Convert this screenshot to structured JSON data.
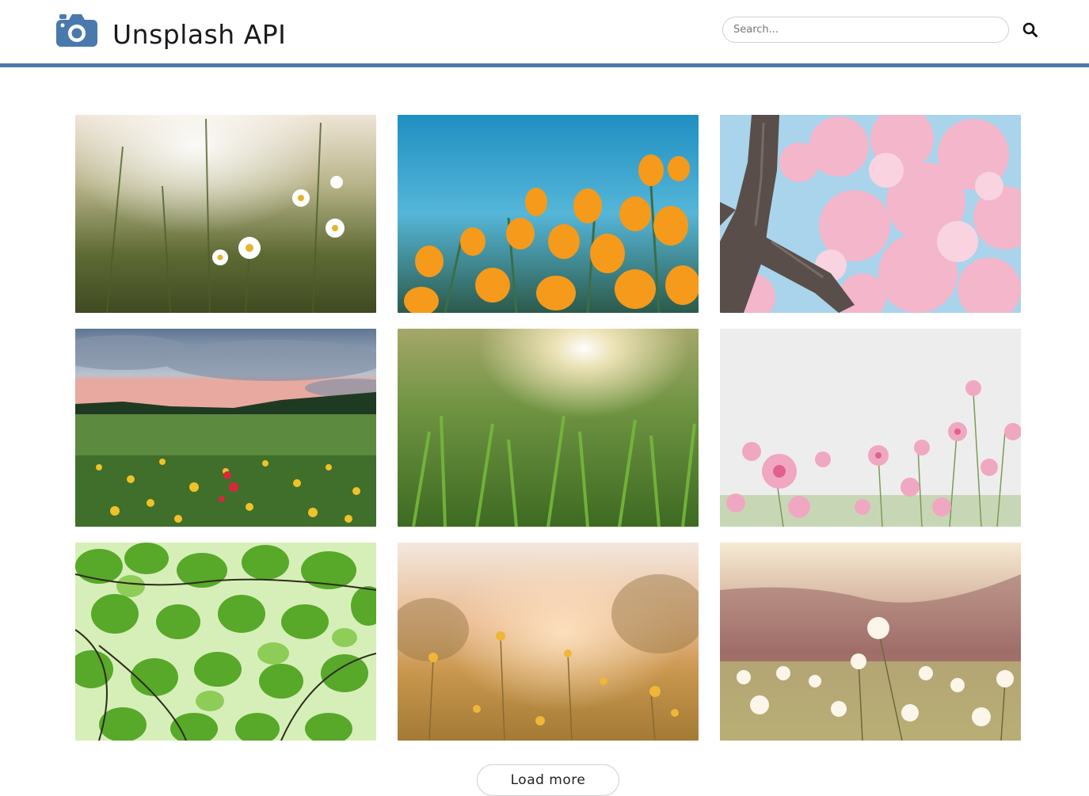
{
  "header": {
    "logo_icon": "camera-icon",
    "title": "Unsplash API",
    "accent_color": "#4a7aad"
  },
  "search": {
    "placeholder": "Search...",
    "value": "",
    "icon": "search-icon"
  },
  "gallery": {
    "photos": [
      {
        "subject": "daisies-meadow-sunset",
        "icon": "image-icon"
      },
      {
        "subject": "orange-poppies-blue-sky",
        "icon": "image-icon"
      },
      {
        "subject": "cherry-blossom-tree",
        "icon": "image-icon"
      },
      {
        "subject": "wildflower-meadow-clouds",
        "icon": "image-icon"
      },
      {
        "subject": "grass-sunlight",
        "icon": "image-icon"
      },
      {
        "subject": "pink-cosmos-flowers",
        "icon": "image-icon"
      },
      {
        "subject": "green-leaves-canopy",
        "icon": "image-icon"
      },
      {
        "subject": "golden-meadow-sunset",
        "icon": "image-icon"
      },
      {
        "subject": "white-daisies-hills",
        "icon": "image-icon"
      }
    ]
  },
  "load_more": {
    "label": "Load more"
  }
}
